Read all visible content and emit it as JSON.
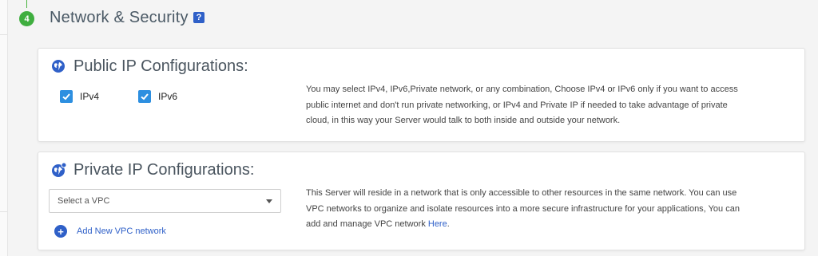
{
  "step": {
    "number": "4",
    "title": "Network & Security",
    "help_glyph": "?"
  },
  "public_ip": {
    "title": "Public IP Configurations:",
    "icon": "globe-icon",
    "checkboxes": [
      {
        "label": "IPv4",
        "checked": true
      },
      {
        "label": "IPv6",
        "checked": true
      }
    ],
    "description_lines": [
      "You may select IPv4, IPv6,Private network, or any combination, Choose IPv4 or IPv6 only if you want to access",
      "public internet and don't run private networking, or IPv4 and Private IP if needed to take advantage of private",
      "cloud, in this way your Server would talk to both inside and outside your network."
    ]
  },
  "private_ip": {
    "title": "Private IP Configurations:",
    "icon": "globe-network-icon",
    "select_placeholder": "Select a VPC",
    "add_vpc_label": "Add New VPC network",
    "description_lines": [
      "This Server will reside in a network that is only accessible to other resources in the same network. You can use",
      "VPC networks to organize and isolate resources into a more secure infrastructure for your applications, You can",
      "add and manage VPC network "
    ],
    "here_link": "Here",
    "here_suffix": "."
  },
  "colors": {
    "accent_green": "#3fae3f",
    "accent_blue": "#2f60c8",
    "checkbox_blue": "#2d8fe0"
  }
}
